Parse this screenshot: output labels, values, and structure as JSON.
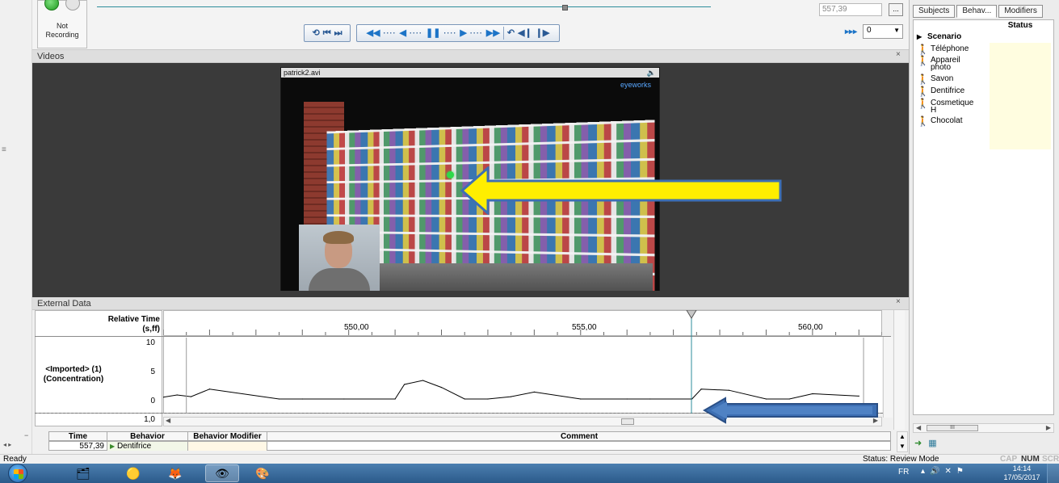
{
  "recording": {
    "status_label": "Not\nRecording"
  },
  "toolbar": {
    "time_value": "557,39",
    "dots_label": "...",
    "speed_value": "0"
  },
  "videos": {
    "panel_title": "Videos",
    "close": "×",
    "video_title": "patrick2.avi",
    "overlay_brand": "eyeworks"
  },
  "external_data": {
    "panel_title": "External Data",
    "close": "×",
    "relative_time_label": "Relative Time\n(s,ff)",
    "track_label": "<Imported> (1)\n(Concentration)"
  },
  "chart_data": {
    "type": "line",
    "x": [
      546.0,
      546.3,
      546.6,
      547.0,
      548.5,
      549.0,
      549.9,
      551.0,
      551.2,
      551.6,
      552.0,
      552.5,
      553.0,
      553.5,
      554.0,
      555.0,
      556.0,
      556.5,
      557.4,
      557.6,
      558.2,
      559.0,
      559.5,
      560.0,
      561.0
    ],
    "y": [
      0.3,
      0.7,
      0.4,
      1.7,
      0.0,
      0.0,
      0.0,
      0.0,
      2.5,
      3.2,
      2.0,
      0.0,
      0.0,
      0.4,
      1.2,
      0.0,
      0.0,
      0.0,
      0.0,
      1.7,
      1.5,
      0.0,
      0.0,
      0.9,
      0.5
    ],
    "x_ticks": [
      "550,00",
      "555,00",
      "560,00"
    ],
    "y_ticks": [
      "10",
      "5",
      "0"
    ],
    "y_lane_scale": "1,0",
    "xlim": [
      546.0,
      561.5
    ],
    "ylim": [
      0,
      10
    ],
    "cursor_time": 557.39,
    "xlabel": "Relative Time (s,ff)",
    "ylabel": "<Imported> (1) (Concentration)",
    "grid": false,
    "color": "#000000"
  },
  "table": {
    "headers": [
      "Time",
      "Behavior",
      "Behavior Modifier",
      "Comment"
    ],
    "rows": [
      {
        "time": "557,39",
        "behavior": "Dentifrice",
        "modifier": "",
        "comment": ""
      }
    ]
  },
  "right_panel": {
    "tabs": [
      "Subjects",
      "Behav...",
      "Modifiers"
    ],
    "status_header": "Status",
    "group": "Scenario",
    "behaviors": [
      "Téléphone",
      "Appareil\nphoto",
      "Savon",
      "Dentifrice",
      "Cosmetique\nH",
      "Chocolat"
    ],
    "scroll_thumb": "III"
  },
  "status_bar": {
    "left": "Ready",
    "mode": "Status: Review Mode",
    "indicators": [
      "CAP",
      "NUM",
      "SCRL"
    ]
  },
  "taskbar": {
    "language": "FR",
    "time": "14:14",
    "date": "17/05/2017",
    "pinned_icons": [
      "folder-icon",
      "chrome-icon",
      "firefox-icon",
      "eye-tracker-icon",
      "paint-icon"
    ]
  },
  "colors": {
    "annotation_arrow_yellow": "#ffee00",
    "annotation_arrow_blue": "#3d6fb3",
    "timeline_accent": "#2d8d9b",
    "cursor_line": "#2d8d9b"
  }
}
